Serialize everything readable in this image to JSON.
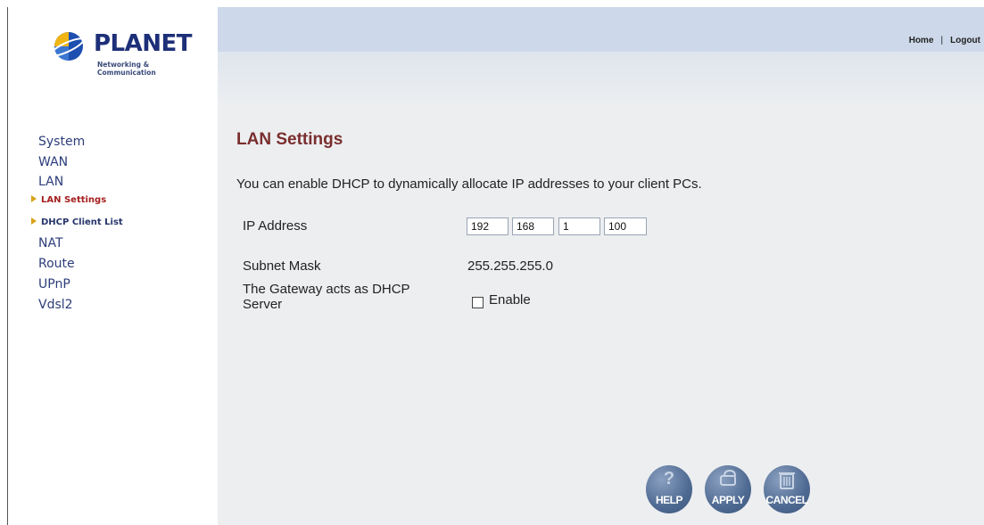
{
  "logo": {
    "word": "PLANET",
    "tagline": "Networking & Communication"
  },
  "header": {
    "links": {
      "home": "Home",
      "logout": "Logout",
      "separator": "|"
    }
  },
  "nav": {
    "system": "System",
    "wan": "WAN",
    "lan": "LAN",
    "lan_settings": "LAN Settings",
    "dhcp_client_list": "DHCP Client List",
    "nat": "NAT",
    "route": "Route",
    "upnp": "UPnP",
    "vdsl2": "Vdsl2"
  },
  "page": {
    "title": "LAN Settings",
    "description": "You can enable DHCP to dynamically allocate IP addresses to your client PCs."
  },
  "form": {
    "ip_label": "IP Address",
    "ip_octets": [
      "192",
      "168",
      "1",
      "100"
    ],
    "subnet_label": "Subnet Mask",
    "subnet_value": "255.255.255.0",
    "dhcp_label_line1": "The Gateway acts as DHCP",
    "dhcp_label_line2": "Server",
    "dhcp_enable_label": "Enable",
    "dhcp_enabled": false
  },
  "buttons": {
    "help": "HELP",
    "apply": "APPLY",
    "cancel": "CANCEL"
  },
  "icons": [
    "planet-globe-icon",
    "triangle-bullet-icon",
    "help-icon",
    "apply-icon",
    "cancel-icon"
  ],
  "colors": {
    "title": "#7a2e2e",
    "nav": "#2c3d7a",
    "active_nav": "#a52020",
    "button": "#4f6a92"
  }
}
